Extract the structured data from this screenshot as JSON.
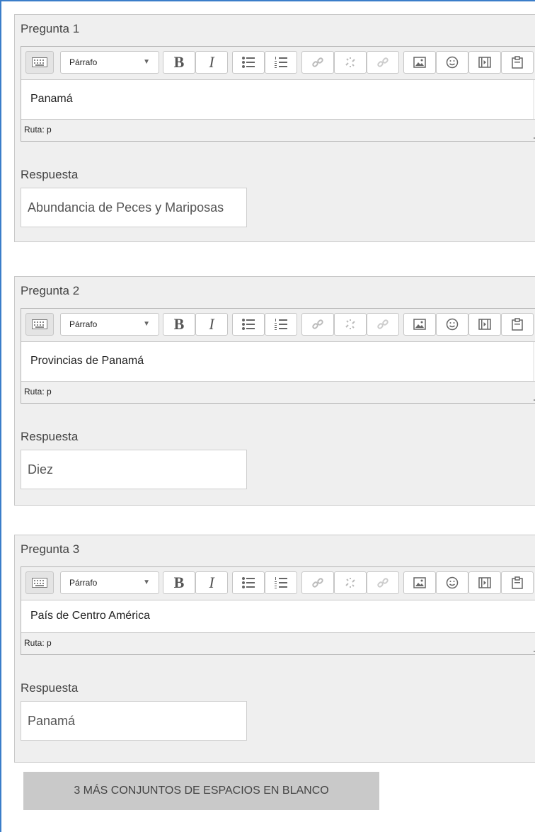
{
  "editor": {
    "format_label": "Párrafo",
    "bold_label": "B",
    "italic_label": "I",
    "path_label": "Ruta: p"
  },
  "questions": [
    {
      "label": "Pregunta 1",
      "content": "Panamá",
      "answer_label": "Respuesta",
      "answer_value": "Abundancia de Peces y Mariposas"
    },
    {
      "label": "Pregunta 2",
      "content": "Provincias de Panamá",
      "answer_label": "Respuesta",
      "answer_value": "Diez"
    },
    {
      "label": "Pregunta 3",
      "content": "País de Centro América",
      "answer_label": "Respuesta",
      "answer_value": "Panamá"
    }
  ],
  "more_button_label": "3 MÁS CONJUNTOS DE ESPACIOS EN BLANCO"
}
